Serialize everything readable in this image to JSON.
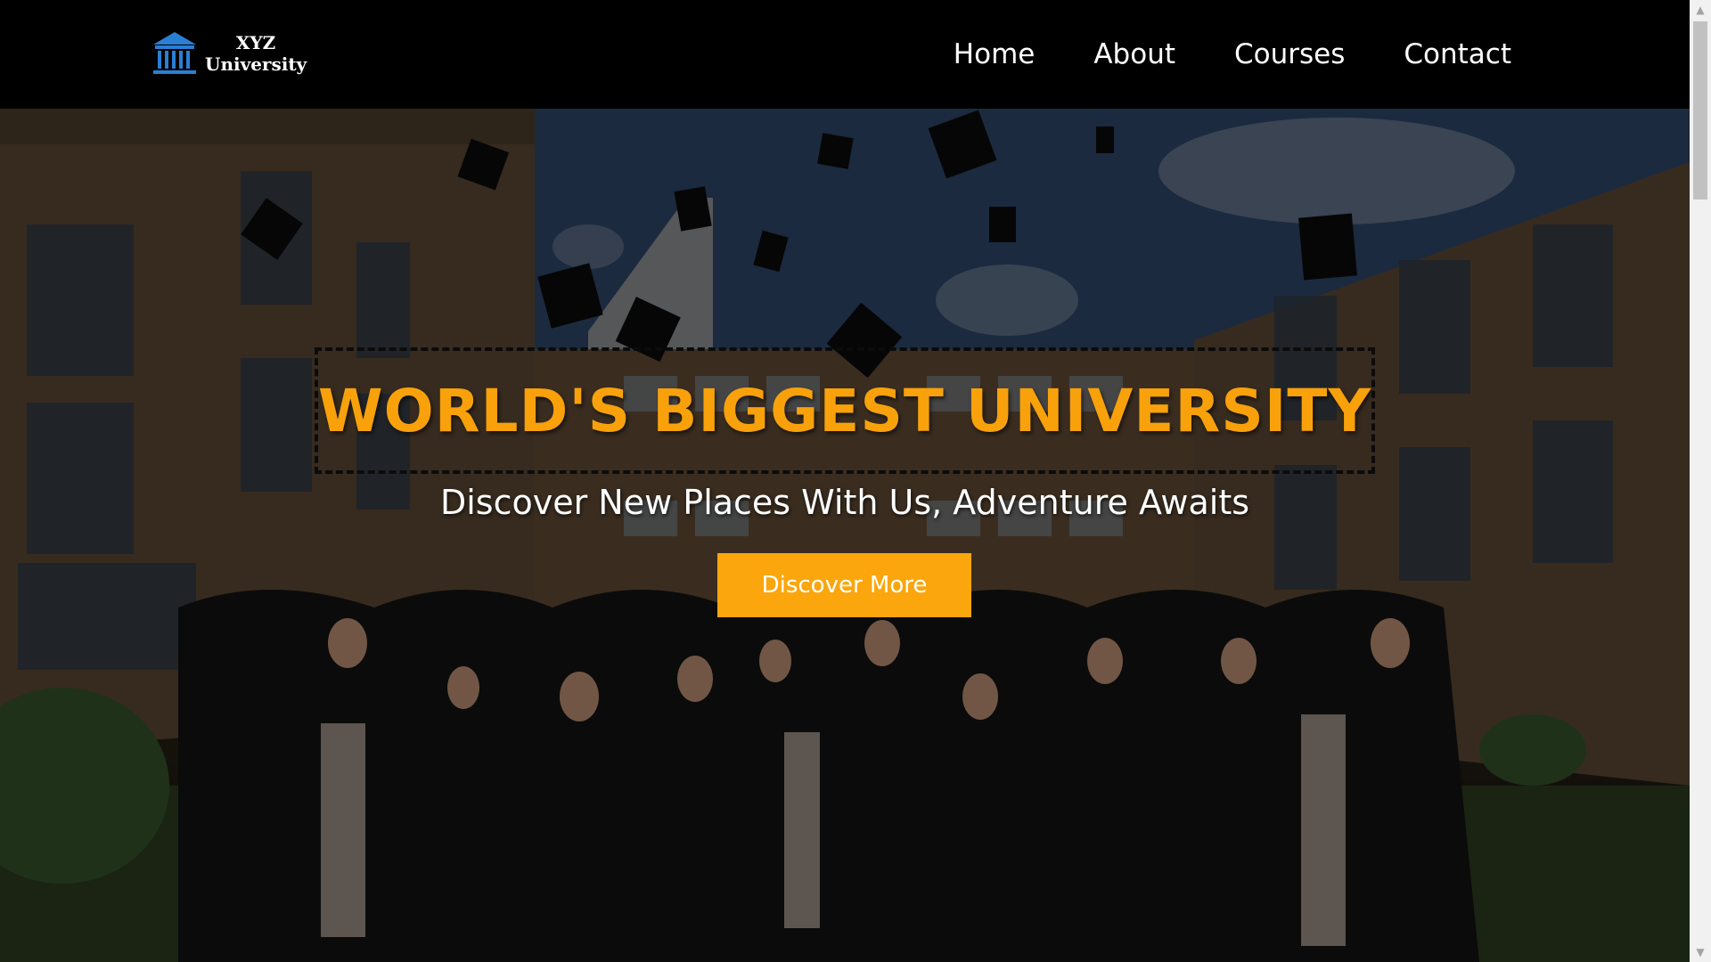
{
  "brand": {
    "name_line1": "XYZ",
    "name_line2": "University",
    "icon": "university-building-icon",
    "accent_color": "#f8a10b"
  },
  "nav": {
    "items": [
      {
        "label": "Home"
      },
      {
        "label": "About"
      },
      {
        "label": "Courses"
      },
      {
        "label": "Contact"
      }
    ]
  },
  "hero": {
    "background": "graduation-crowd-photo",
    "headline": "WORLD'S BIGGEST UNIVERSITY",
    "subheadline": "Discover New Places With Us, Adventure Awaits",
    "cta_label": "Discover More",
    "cta_color": "#fba60c"
  },
  "scrollbar": {
    "up_icon": "scroll-up-icon",
    "down_icon": "scroll-down-icon"
  }
}
